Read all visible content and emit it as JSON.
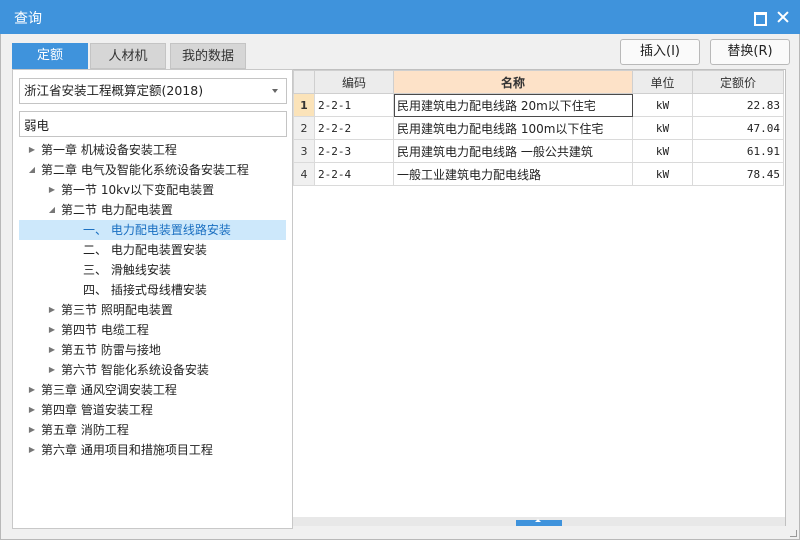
{
  "window": {
    "title": "查询"
  },
  "tabs": [
    {
      "label": "定额",
      "active": true
    },
    {
      "label": "人材机",
      "active": false
    },
    {
      "label": "我的数据",
      "active": false
    }
  ],
  "actions": {
    "insert_label": "插入(I)",
    "replace_label": "替换(R)"
  },
  "left_panel": {
    "library_select_value": "浙江省安装工程概算定额(2018)",
    "search_value": "弱电",
    "tree": [
      {
        "level": 0,
        "toggle": "collapsed",
        "label": "第一章 机械设备安装工程"
      },
      {
        "level": 0,
        "toggle": "expanded",
        "label": "第二章 电气及智能化系统设备安装工程"
      },
      {
        "level": 1,
        "toggle": "collapsed",
        "label": "第一节 10kv以下变配电装置"
      },
      {
        "level": 1,
        "toggle": "expanded",
        "label": "第二节 电力配电装置"
      },
      {
        "level": 2,
        "toggle": "none",
        "label": "一、 电力配电装置线路安装",
        "selected": true
      },
      {
        "level": 2,
        "toggle": "none",
        "label": "二、 电力配电装置安装"
      },
      {
        "level": 2,
        "toggle": "none",
        "label": "三、 滑触线安装"
      },
      {
        "level": 2,
        "toggle": "none",
        "label": "四、 插接式母线槽安装"
      },
      {
        "level": 1,
        "toggle": "collapsed",
        "label": "第三节 照明配电装置"
      },
      {
        "level": 1,
        "toggle": "collapsed",
        "label": "第四节 电缆工程"
      },
      {
        "level": 1,
        "toggle": "collapsed",
        "label": "第五节 防雷与接地"
      },
      {
        "level": 1,
        "toggle": "collapsed",
        "label": "第六节 智能化系统设备安装"
      },
      {
        "level": 0,
        "toggle": "collapsed",
        "label": "第三章 通风空调安装工程"
      },
      {
        "level": 0,
        "toggle": "collapsed",
        "label": "第四章 管道安装工程"
      },
      {
        "level": 0,
        "toggle": "collapsed",
        "label": "第五章 消防工程"
      },
      {
        "level": 0,
        "toggle": "collapsed",
        "label": "第六章 通用项目和措施项目工程"
      }
    ]
  },
  "grid": {
    "columns": [
      "编码",
      "名称",
      "单位",
      "定额价"
    ],
    "rows": [
      {
        "no": "1",
        "code": "2-2-1",
        "name": "民用建筑电力配电线路 20m以下住宅",
        "unit": "kW",
        "price": "22.83",
        "selected": true
      },
      {
        "no": "2",
        "code": "2-2-2",
        "name": "民用建筑电力配电线路 100m以下住宅",
        "unit": "kW",
        "price": "47.04"
      },
      {
        "no": "3",
        "code": "2-2-3",
        "name": "民用建筑电力配电线路 一般公共建筑",
        "unit": "kW",
        "price": "61.91"
      },
      {
        "no": "4",
        "code": "2-2-4",
        "name": "一般工业建筑电力配电线路",
        "unit": "kW",
        "price": "78.45"
      }
    ]
  },
  "colors": {
    "accent": "#3f93dc",
    "selected_tree_bg": "#cde8fb",
    "name_header_bg": "#fde2c8"
  },
  "icons": {
    "maximize": "maximize-icon",
    "close": "close-icon",
    "dropdown": "chevron-down-icon",
    "tree_collapsed": "triangle-right-icon",
    "tree_expanded": "triangle-down-icon"
  }
}
